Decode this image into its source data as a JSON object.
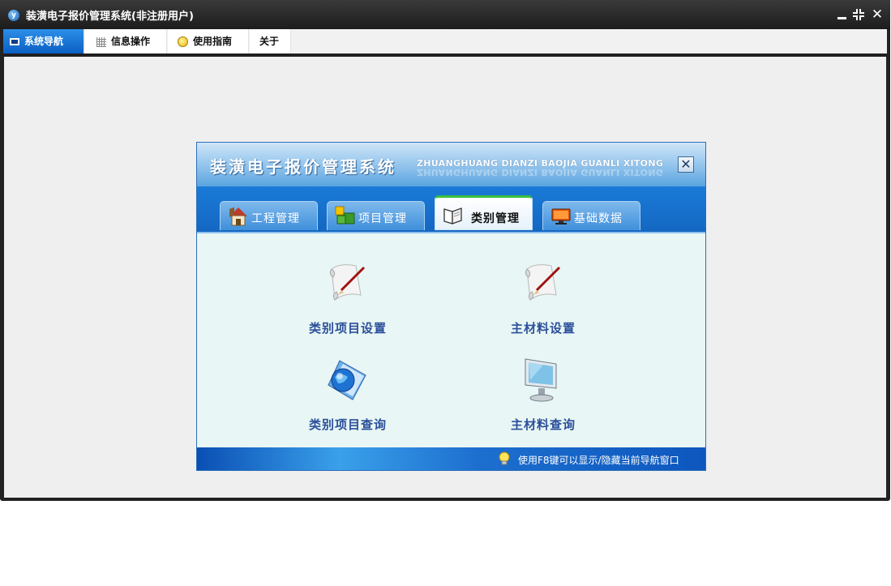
{
  "window": {
    "title": "装潢电子报价管理系统(非注册用户)",
    "logo_glyph": "y"
  },
  "window_controls": {
    "close_glyph": "✕"
  },
  "menubar": {
    "items": [
      {
        "label": "系统导航",
        "icon": "monitor-icon",
        "active": true
      },
      {
        "label": "信息操作",
        "icon": "grid-icon",
        "active": false
      },
      {
        "label": "使用指南",
        "icon": "bulb-icon",
        "active": false
      },
      {
        "label": "关于",
        "icon": "",
        "active": false
      }
    ]
  },
  "nav_panel": {
    "title": "装潢电子报价管理系统",
    "subtitle": "ZHUANGHUANG DIANZI BAOJIA GUANLI XITONG",
    "close_glyph": "✕",
    "tabs": [
      {
        "label": "工程管理",
        "icon": "house-icon",
        "active": false
      },
      {
        "label": "项目管理",
        "icon": "cubes-icon",
        "active": false
      },
      {
        "label": "类别管理",
        "icon": "book-icon",
        "active": true
      },
      {
        "label": "基础数据",
        "icon": "display-icon",
        "active": false
      }
    ],
    "tiles": [
      {
        "label": "类别项目设置",
        "icon": "scroll-pen-icon"
      },
      {
        "label": "主材料设置",
        "icon": "scroll-pen-icon"
      },
      {
        "label": "类别项目查询",
        "icon": "globe-book-icon"
      },
      {
        "label": "主材料查询",
        "icon": "lcd-monitor-icon"
      }
    ],
    "footer_tip": "使用F8键可以显示/隐藏当前导航窗口"
  },
  "colors": {
    "accent_blue": "#0b5fc4",
    "tile_label": "#2b4f9a",
    "active_tab_marker": "#3cc03c"
  }
}
